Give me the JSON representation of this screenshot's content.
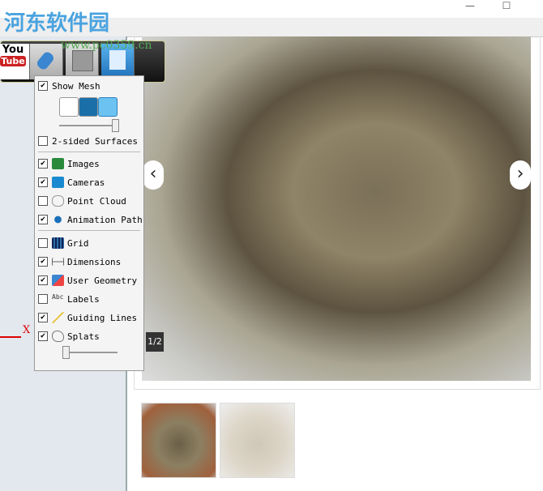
{
  "window": {
    "minimize": "—",
    "maximize": "☐"
  },
  "watermark": {
    "name": "河东软件园",
    "url": "www.pc0359.cn"
  },
  "viewport": {
    "axis_label": "X",
    "axis_color": "#dd0000"
  },
  "toolbar": {
    "youtube_top": "You",
    "youtube_bottom": "Tube"
  },
  "menu": {
    "show_mesh": {
      "label": "Show Mesh",
      "checked": true
    },
    "two_sided": {
      "label": "2-sided Surfaces",
      "checked": false
    },
    "items1": [
      {
        "label": "Images",
        "checked": true,
        "icon": "image-icon"
      },
      {
        "label": "Cameras",
        "checked": true,
        "icon": "camera-icon"
      },
      {
        "label": "Point Cloud",
        "checked": false,
        "icon": "point-cloud-icon"
      },
      {
        "label": "Animation Path",
        "checked": true,
        "icon": "animation-path-icon"
      }
    ],
    "items2": [
      {
        "label": "Grid",
        "checked": false,
        "icon": "grid-icon"
      },
      {
        "label": "Dimensions",
        "checked": true,
        "icon": "dimensions-icon"
      },
      {
        "label": "User Geometry",
        "checked": true,
        "icon": "user-geometry-icon"
      },
      {
        "label": "Labels",
        "checked": false,
        "icon": "labels-icon"
      },
      {
        "label": "Guiding Lines",
        "checked": true,
        "icon": "guiding-lines-icon"
      },
      {
        "label": "Splats",
        "checked": true,
        "icon": "splats-icon"
      }
    ],
    "mesh_slider": 1.0,
    "splats_slider": 0.1
  },
  "gallery": {
    "counter": "1/2",
    "prev": "‹",
    "next": "›"
  }
}
